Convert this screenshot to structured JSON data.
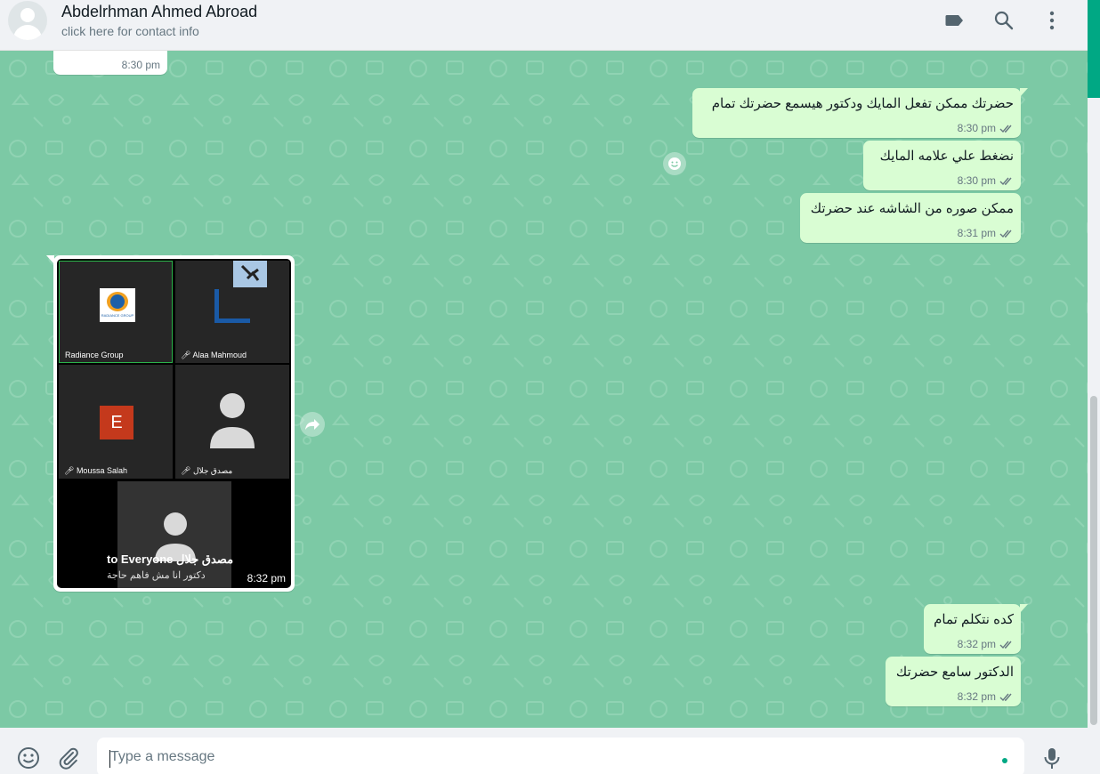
{
  "header": {
    "contact_name": "Abdelrhman Ahmed Abroad",
    "contact_sub": "click here for contact info",
    "icons": [
      "label-icon",
      "search-icon",
      "menu-icon"
    ]
  },
  "messages": [
    {
      "id": "m0",
      "direction": "in",
      "text": "",
      "time": "8:30 pm"
    },
    {
      "id": "m1",
      "direction": "out",
      "text": "حضرتك ممكن تفعل المايك ودكتور هيسمع حضرتك تمام",
      "time": "8:30 pm"
    },
    {
      "id": "m2",
      "direction": "out",
      "text": "نضغط علي علامه المايك",
      "time": "8:30 pm"
    },
    {
      "id": "m3",
      "direction": "out",
      "text": "ممكن صوره من الشاشه عند حضرتك",
      "time": "8:31 pm"
    },
    {
      "id": "m4",
      "direction": "in",
      "type": "image",
      "time": "8:32 pm"
    },
    {
      "id": "m5",
      "direction": "out",
      "text": "كده نتكلم تمام",
      "time": "8:32 pm"
    },
    {
      "id": "m6",
      "direction": "out",
      "text": "الدكتور سامع حضرتك",
      "time": "8:32 pm"
    }
  ],
  "screenshot": {
    "tiles": [
      {
        "label": "Radiance Group",
        "logo_text": "RADIANCE GROUP"
      },
      {
        "label": "Alaa Mahmoud"
      },
      {
        "label": "Moussa Salah",
        "initial": "E"
      },
      {
        "label": "مصدق جلال"
      }
    ],
    "chat_sender": "مصدق جلال",
    "chat_to": "to Everyone",
    "chat_text": "دكتور انا مش فاهم حاجة"
  },
  "footer": {
    "placeholder": "Type a message"
  },
  "colors": {
    "chat_bg": "#7cc9a5",
    "out_bubble": "#d9fdd3",
    "accent": "#00a884",
    "tick": "#667781"
  }
}
